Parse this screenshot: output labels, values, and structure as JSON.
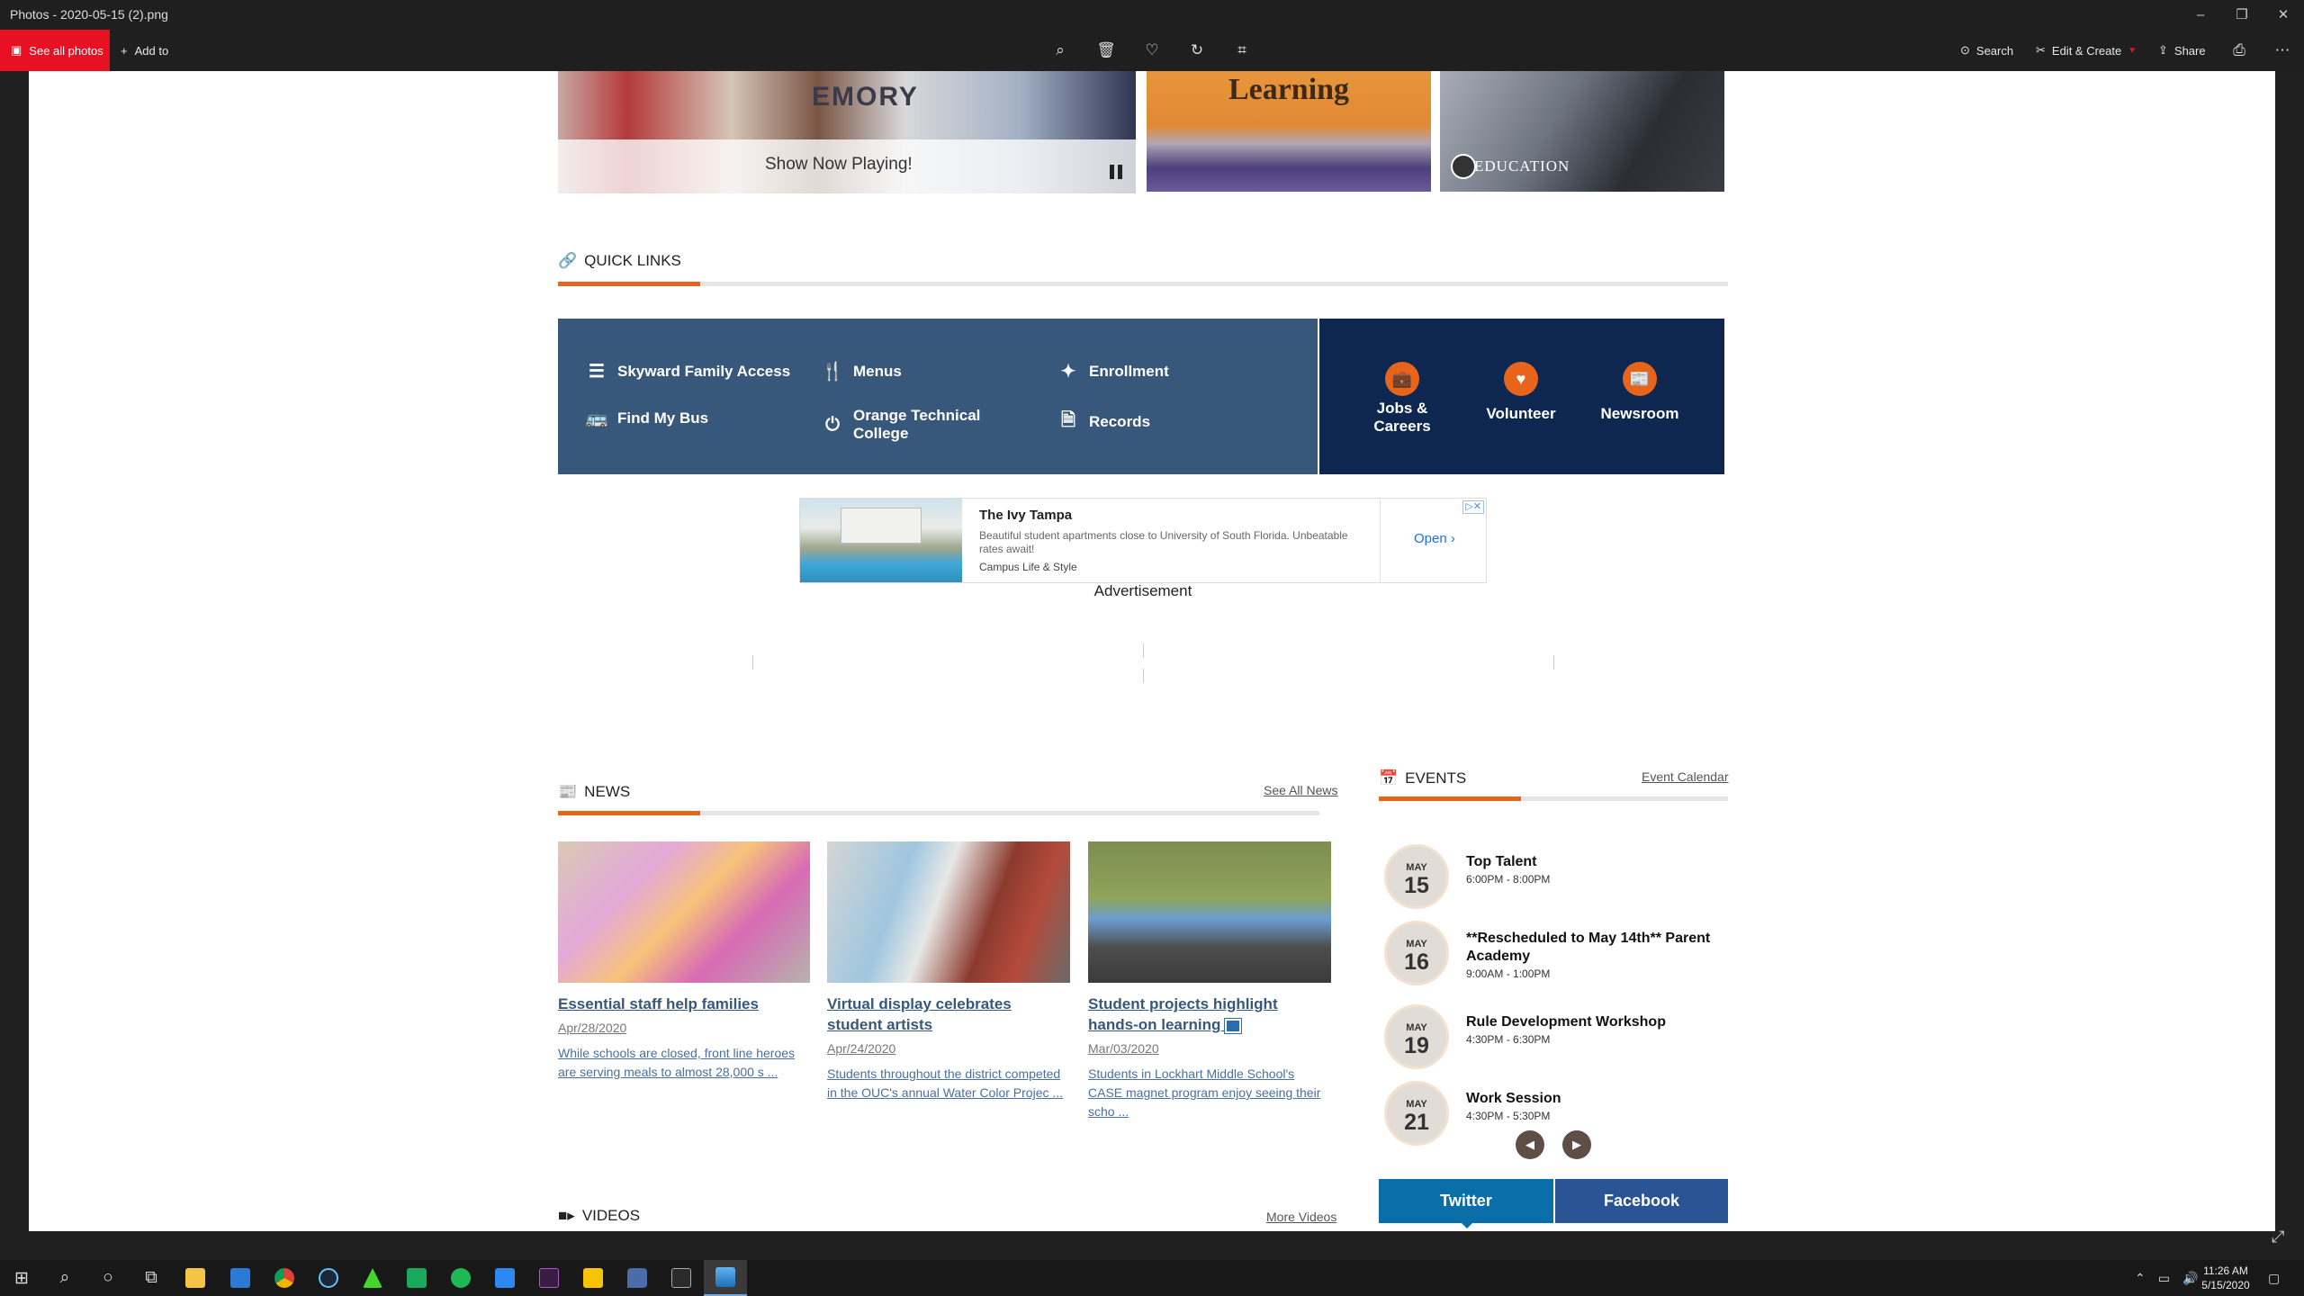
{
  "window": {
    "title": "Photos - 2020-05-15 (2).png",
    "controls": {
      "minimize": "–",
      "restore": "❐",
      "close": "✕"
    }
  },
  "toolbar": {
    "see_all_label": "See all photos",
    "add_to_label": "Add to",
    "search_label": "Search",
    "edit_create_label": "Edit & Create",
    "share_label": "Share",
    "more": "⋯"
  },
  "page": {
    "hero": {
      "now_playing": "Show Now Playing!",
      "shirt_text": "EMORY",
      "learning_text": "Learning",
      "edu_text": "EDUCATION"
    },
    "quick_links": {
      "heading": "QUICK LINKS",
      "items": [
        {
          "label": "Skyward Family Access",
          "icon": "list-icon"
        },
        {
          "label": "Menus",
          "icon": "utensils-icon"
        },
        {
          "label": "Enrollment",
          "icon": "enrollment-icon"
        },
        {
          "label": "Find My Bus",
          "icon": "bus-icon"
        },
        {
          "label": "Orange Technical College",
          "icon": "power-icon"
        },
        {
          "label": "Records",
          "icon": "document-icon"
        }
      ],
      "featured": [
        {
          "label": "Jobs & Careers",
          "icon": "briefcase-icon"
        },
        {
          "label": "Volunteer",
          "icon": "heart-icon"
        },
        {
          "label": "Newsroom",
          "icon": "newspaper-icon"
        }
      ]
    },
    "ad": {
      "name": "The Ivy Tampa",
      "description": "Beautiful student apartments close to University of South Florida. Unbeatable rates await!",
      "category": "Campus Life & Style",
      "open_label": "Open",
      "label": "Advertisement"
    },
    "news": {
      "heading": "NEWS",
      "see_all": "See All News",
      "articles": [
        {
          "title": "Essential staff help families",
          "date": "Apr/28/2020",
          "summary": "While schools are closed, front line heroes are serving meals to almost 28,000 s ..."
        },
        {
          "title": "Virtual display celebrates student artists",
          "date": "Apr/24/2020",
          "summary": "Students throughout the district competed in the OUC's annual Water Color Projec ..."
        },
        {
          "title": "Student projects highlight hands-on learning",
          "date": "Mar/03/2020",
          "summary": "Students in Lockhart Middle School's CASE magnet program enjoy seeing their scho ..."
        }
      ]
    },
    "events": {
      "heading": "EVENTS",
      "calendar_link": "Event Calendar",
      "items": [
        {
          "month": "MAY",
          "day": "15",
          "title": "Top Talent",
          "time": "6:00PM - 8:00PM"
        },
        {
          "month": "MAY",
          "day": "16",
          "title": "**Rescheduled to May 14th** Parent Academy",
          "time": "9:00AM - 1:00PM"
        },
        {
          "month": "MAY",
          "day": "19",
          "title": "Rule Development Workshop",
          "time": "4:30PM - 6:30PM"
        },
        {
          "month": "MAY",
          "day": "21",
          "title": "Work Session",
          "time": "4:30PM - 5:30PM"
        }
      ]
    },
    "social": {
      "twitter": "Twitter",
      "facebook": "Facebook"
    },
    "videos": {
      "heading": "VIDEOS",
      "more": "More Videos"
    }
  },
  "taskbar": {
    "time": "11:26 AM",
    "date": "5/15/2020"
  },
  "colors": {
    "accent": "#e8641b",
    "quick_links_bg": "#37587a",
    "featured_bg": "#0d2750",
    "photos_red": "#e81123",
    "twitter": "#0a6fa9",
    "facebook": "#2a5494"
  }
}
